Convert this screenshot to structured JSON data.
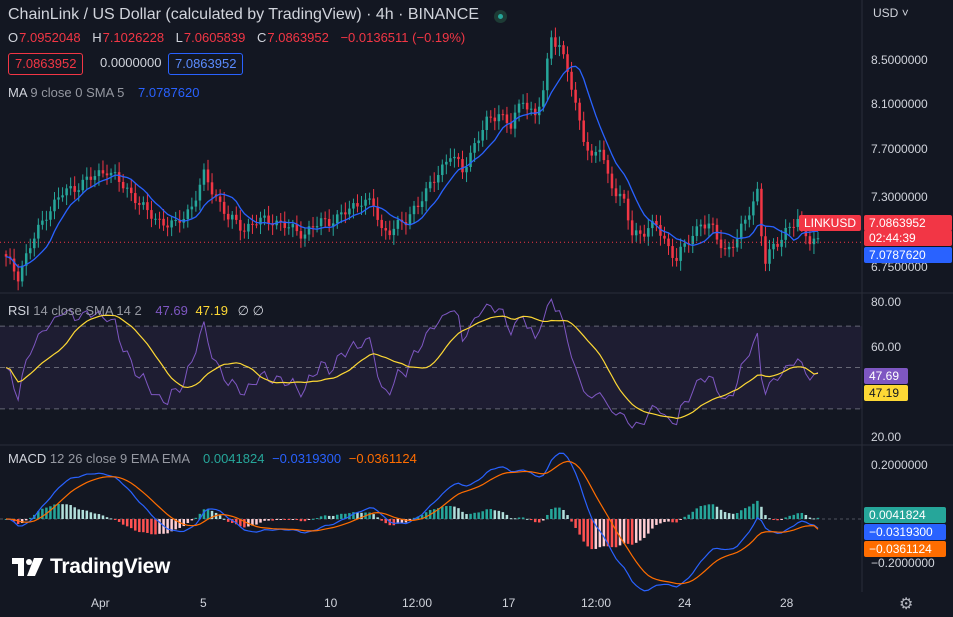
{
  "header": {
    "title": "ChainLink / US Dollar (calculated by TradingView) · 4h · BINANCE",
    "currency": "USD",
    "ohlc": {
      "o_label": "O",
      "o": "7.0952048",
      "h_label": "H",
      "h": "7.1026228",
      "l_label": "L",
      "l": "7.0605839",
      "c_label": "C",
      "c": "7.0863952",
      "change": "−0.0136511 (−0.19%)"
    },
    "sell_price": "7.0863952",
    "spread": "0.0000000",
    "buy_price": "7.0863952"
  },
  "legends": {
    "ma": {
      "name": "MA",
      "params": "9 close 0 SMA 5",
      "value": "7.0787620"
    },
    "rsi": {
      "name": "RSI",
      "params": "14 close SMA 14 2",
      "value1": "47.69",
      "value2": "47.19",
      "extra": "∅ ∅"
    },
    "macd": {
      "name": "MACD",
      "params": "12 26 close 9 EMA EMA",
      "hist": "0.0041824",
      "macd": "−0.0319300",
      "signal": "−0.0361124"
    }
  },
  "price_axis": {
    "ticks": [
      "8.5000000",
      "8.1000000",
      "7.7000000",
      "7.3000000",
      "6.7500000"
    ],
    "symbol_tag": "LINKUSD",
    "last_price": "7.0863952",
    "countdown": "02:44:39",
    "ma_last": "7.0787620"
  },
  "rsi_axis": {
    "ticks": [
      "80.00",
      "60.00",
      "20.00"
    ],
    "rsi_last": "47.69",
    "rsi_ma_last": "47.19"
  },
  "macd_axis": {
    "ticks": [
      "0.2000000",
      "−0.2000000"
    ],
    "hist_last": "0.0041824",
    "macd_last": "−0.0319300",
    "signal_last": "−0.0361124"
  },
  "time_axis": {
    "labels": [
      "Apr",
      "5",
      "10",
      "12:00",
      "17",
      "12:00",
      "24",
      "28"
    ]
  },
  "branding": {
    "logo_text": "TradingView"
  },
  "colors": {
    "bg": "#131722",
    "up": "#26a69a",
    "down": "#f23645",
    "ma": "#2962ff",
    "rsi": "#7e57c2",
    "rsi_ma": "#fdd835",
    "macd": "#2962ff",
    "signal": "#ff6d00",
    "hist_up_strong": "#26a69a",
    "hist_up_weak": "#b2dfdb",
    "hist_down_strong": "#ff5252",
    "hist_down_weak": "#ffcdd2"
  },
  "chart_data": {
    "type": "candlestick",
    "interval": "4h",
    "symbol": "LINKUSD",
    "x_tick_labels": [
      "Apr",
      "5",
      "10",
      "12:00",
      "17",
      "12:00",
      "24",
      "28"
    ],
    "price_range": [
      6.7,
      8.9
    ],
    "price_anchors": [
      [
        0,
        6.95
      ],
      [
        3,
        6.82
      ],
      [
        6,
        7.05
      ],
      [
        10,
        7.32
      ],
      [
        14,
        7.48
      ],
      [
        18,
        7.55
      ],
      [
        22,
        7.62
      ],
      [
        25,
        7.68
      ],
      [
        28,
        7.57
      ],
      [
        32,
        7.45
      ],
      [
        35,
        7.32
      ],
      [
        38,
        7.26
      ],
      [
        42,
        7.22
      ],
      [
        46,
        7.38
      ],
      [
        49,
        7.62
      ],
      [
        52,
        7.46
      ],
      [
        55,
        7.28
      ],
      [
        59,
        7.2
      ],
      [
        62,
        7.25
      ],
      [
        66,
        7.27
      ],
      [
        70,
        7.2
      ],
      [
        74,
        7.16
      ],
      [
        78,
        7.25
      ],
      [
        82,
        7.28
      ],
      [
        85,
        7.35
      ],
      [
        88,
        7.43
      ],
      [
        91,
        7.38
      ],
      [
        93,
        7.18
      ],
      [
        96,
        7.2
      ],
      [
        99,
        7.25
      ],
      [
        101,
        7.37
      ],
      [
        104,
        7.48
      ],
      [
        107,
        7.65
      ],
      [
        110,
        7.8
      ],
      [
        113,
        7.66
      ],
      [
        116,
        7.88
      ],
      [
        119,
        8.05
      ],
      [
        122,
        8.14
      ],
      [
        125,
        8.02
      ],
      [
        128,
        8.25
      ],
      [
        131,
        8.1
      ],
      [
        133,
        8.3
      ],
      [
        135,
        8.76
      ],
      [
        137,
        8.68
      ],
      [
        139,
        8.47
      ],
      [
        141,
        8.18
      ],
      [
        143,
        7.95
      ],
      [
        145,
        7.75
      ],
      [
        147,
        7.85
      ],
      [
        149,
        7.62
      ],
      [
        151,
        7.5
      ],
      [
        153,
        7.4
      ],
      [
        155,
        7.15
      ],
      [
        158,
        7.18
      ],
      [
        161,
        7.22
      ],
      [
        164,
        7.05
      ],
      [
        166,
        6.95
      ],
      [
        169,
        7.1
      ],
      [
        172,
        7.25
      ],
      [
        175,
        7.18
      ],
      [
        178,
        7.02
      ],
      [
        181,
        7.1
      ],
      [
        184,
        7.35
      ],
      [
        186,
        7.5
      ],
      [
        187,
        7.15
      ],
      [
        188,
        6.92
      ],
      [
        190,
        7.05
      ],
      [
        193,
        7.18
      ],
      [
        196,
        7.25
      ],
      [
        199,
        7.12
      ],
      [
        201,
        7.09
      ]
    ],
    "rsi_range": [
      15,
      85
    ],
    "rsi_levels": [
      70,
      50,
      30
    ],
    "macd_range": [
      -0.25,
      0.25
    ],
    "last": {
      "close": 7.0863952,
      "ma": 7.078762,
      "rsi": 47.69,
      "rsi_ma": 47.19,
      "hist": 0.0041824,
      "macd": -0.03193,
      "signal": -0.0361124
    }
  }
}
